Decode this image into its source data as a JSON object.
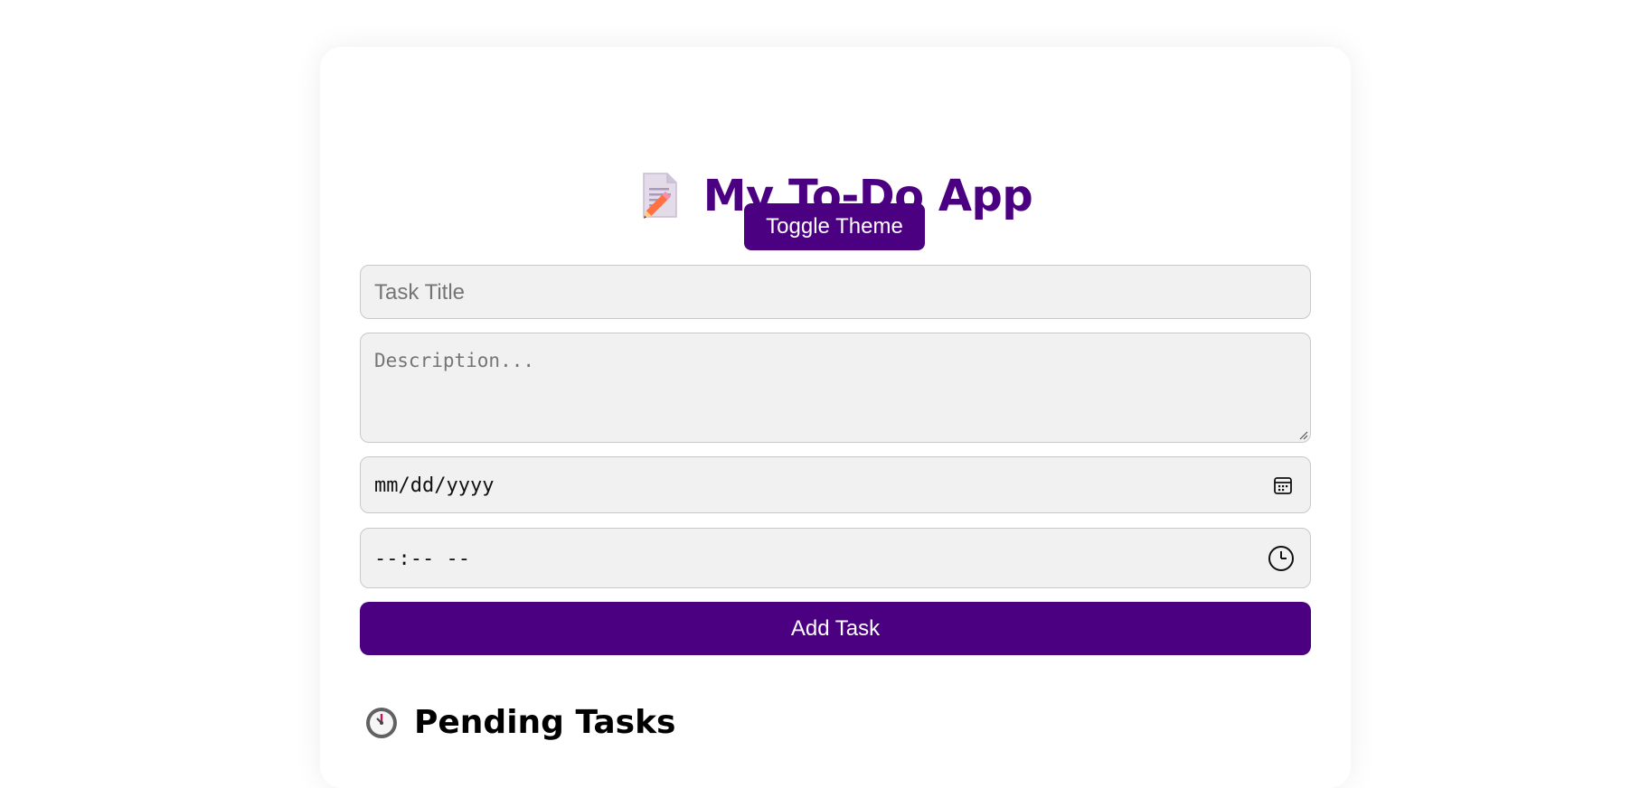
{
  "app": {
    "title": "My To-Do App",
    "title_icon": "memo-icon",
    "accent_color": "#4b0082"
  },
  "toolbar": {
    "toggle_theme_label": "Toggle Theme"
  },
  "form": {
    "task_title": {
      "value": "",
      "placeholder": "Task Title"
    },
    "description": {
      "value": "",
      "placeholder": "Description..."
    },
    "due_date": {
      "display": "mm/dd/yyyy",
      "icon": "calendar-icon"
    },
    "due_time": {
      "display": "--:-- --",
      "icon": "clock-icon"
    },
    "add_button_label": "Add Task"
  },
  "sections": {
    "pending": {
      "label": "Pending Tasks",
      "icon": "stopwatch-icon"
    }
  }
}
